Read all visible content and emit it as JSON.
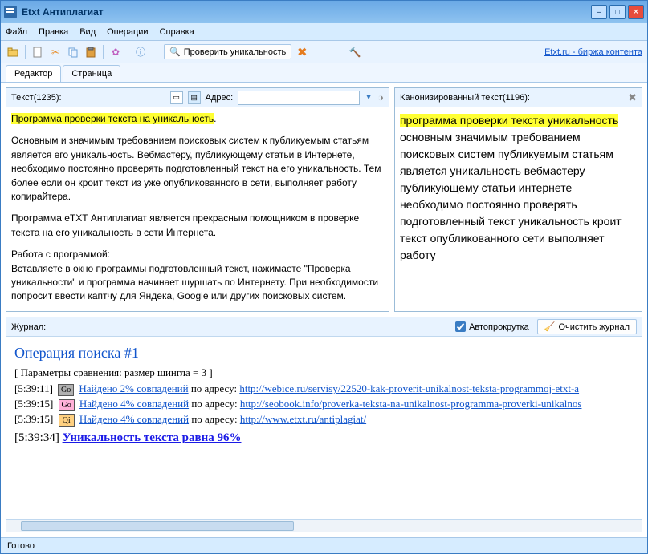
{
  "title": "Etxt Антиплагиат",
  "menu": {
    "file": "Файл",
    "edit": "Правка",
    "view": "Вид",
    "ops": "Операции",
    "help": "Справка"
  },
  "toolbar": {
    "check": "Проверить уникальность",
    "link": "Etxt.ru - биржа контента"
  },
  "tabs": {
    "editor": "Редактор",
    "page": "Страница"
  },
  "editor": {
    "textLabel": "Текст(1235):",
    "addrLabel": "Адрес:",
    "addrValue": "",
    "hl1": "Программа проверки текста на уникальность",
    "p1_rest": ".",
    "p2": "Основным и значимым требованием поисковых систем к публикуемым статьям является его уникальность. Вебмастеру, публикующему статьи в Интернете, необходимо постоянно проверять подготовленный текст на его уникальность. Тем более если он кроит текст из уже опубликованного в сети, выполняет работу копирайтера.",
    "p3": "Программа еТХТ Антиплагиат является прекрасным помощником в проверке текста на его уникальность в сети Интернета.",
    "p4": "Работа с программой:\nВставляете в окно программы подготовленный текст, нажимаете \"Проверка уникальности\" и программа начинает шуршать по Интернету. При необходимости попросит ввести каптчу для Яндека, Google или других поисковых систем."
  },
  "canon": {
    "label": "Канонизированный текст(1196):",
    "hl": "программа проверки текста уникальность",
    "rest": " основным значимым требованием поисковых систем публикуемым статьям является уникальность вебмастеру публикующему статьи интернете необходимо постоянно проверять подготовленный текст уникальность кроит текст опубликованного сети выполняет работу"
  },
  "journal": {
    "label": "Журнал:",
    "autoscroll": "Автопрокрутка",
    "clear": "Очистить журнал",
    "opTitle": "Операция поиска #1",
    "params": "[ Параметры сравнения: размер шингла = 3 ]",
    "lines": [
      {
        "time": "[5:39:11]",
        "badge": "Go",
        "badgeClass": "src-go1",
        "found": "Найдено 2% совпадений",
        "mid": " по адресу: ",
        "url": "http://webice.ru/servisy/22520-kak-proverit-unikalnost-teksta-programmoj-etxt-a"
      },
      {
        "time": "[5:39:15]",
        "badge": "Go",
        "badgeClass": "src-go2",
        "found": "Найдено 4% совпадений",
        "mid": " по адресу: ",
        "url": "http://seobook.info/proverka-teksta-na-unikalnost-programma-proverki-unikalnos"
      },
      {
        "time": "[5:39:15]",
        "badge": "Qi",
        "badgeClass": "src-qi",
        "found": "Найдено 4% совпадений",
        "mid": " по адресу: ",
        "url": "http://www.etxt.ru/antiplagiat/"
      }
    ],
    "resultTime": "[5:39:34]",
    "resultText": "Уникальность текста равна 96%"
  },
  "status": "Готово"
}
